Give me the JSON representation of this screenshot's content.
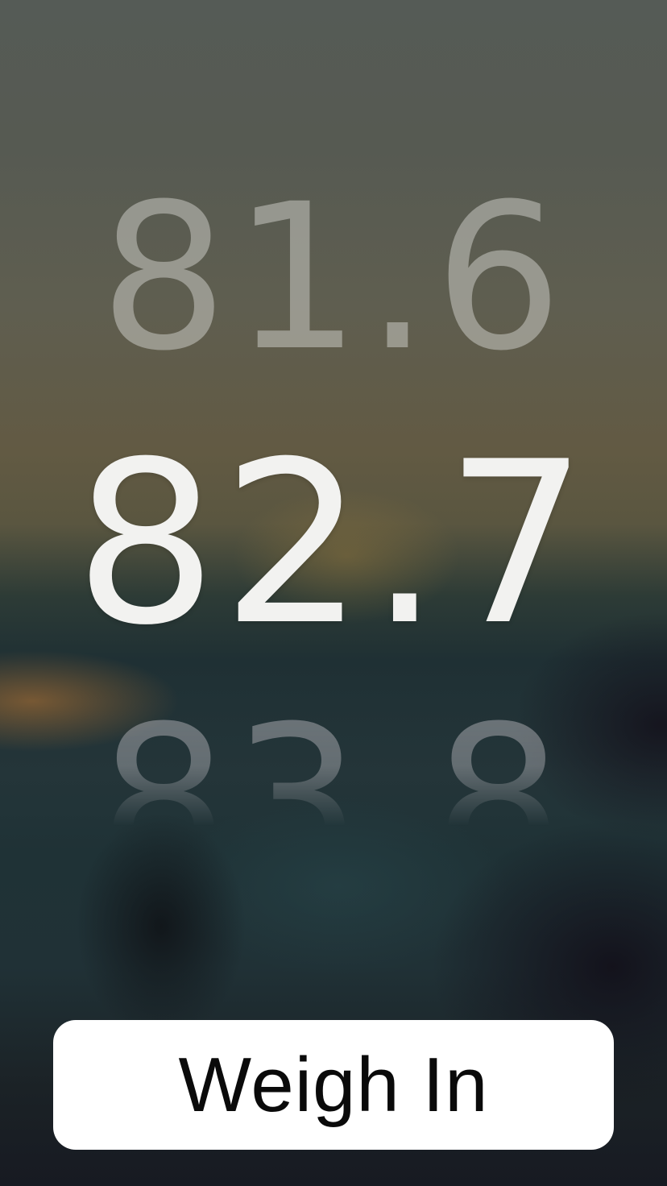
{
  "picker": {
    "previous_value": "81.6",
    "current_value": "82.7",
    "next_value": "83.8"
  },
  "actions": {
    "weigh_in_label": "Weigh In"
  }
}
